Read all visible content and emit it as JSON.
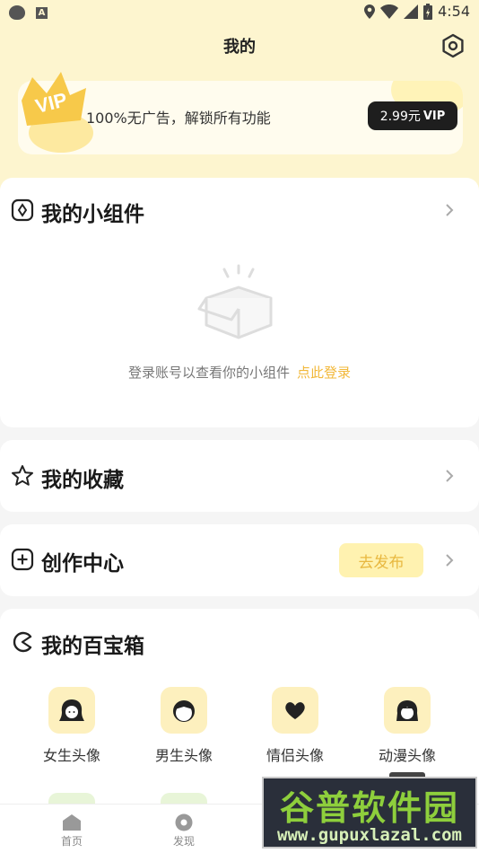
{
  "status_bar": {
    "time": "4:54",
    "notif_letter": "A"
  },
  "header": {
    "title": "我的"
  },
  "vip": {
    "badge": "VIP",
    "text": "100%无广告，解锁所有功能",
    "price": "2.99元",
    "price_suffix": "VIP"
  },
  "widgets": {
    "title": "我的小组件",
    "empty_text": "登录账号以查看你的小组件",
    "login_link": "点此登录"
  },
  "favorites": {
    "title": "我的收藏"
  },
  "creation": {
    "title": "创作中心",
    "publish_label": "去发布"
  },
  "toolbox": {
    "title": "我的百宝箱",
    "items": [
      {
        "label": "女生头像",
        "icon": "girl-avatar-icon"
      },
      {
        "label": "男生头像",
        "icon": "boy-avatar-icon"
      },
      {
        "label": "情侣头像",
        "icon": "heart-icon"
      },
      {
        "label": "动漫头像",
        "icon": "anime-avatar-icon"
      }
    ]
  },
  "bottom_nav": {
    "items": [
      {
        "label": "首页",
        "icon": "home-icon"
      },
      {
        "label": "发现",
        "icon": "discover-icon"
      }
    ]
  },
  "watermark": {
    "title": "谷普软件园",
    "url": "www.gupuxlazal.com"
  },
  "colors": {
    "header_bg": "#fdf5cf",
    "accent_yellow": "#f2b83a",
    "price_button_bg": "#1e1e1e",
    "page_bg": "#f5f5f5"
  }
}
